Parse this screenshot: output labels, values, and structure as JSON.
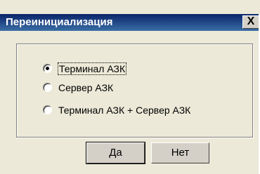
{
  "window": {
    "title": "Переинициализация",
    "close_glyph": "X"
  },
  "options": [
    {
      "label": "Терминал АЗК",
      "selected": true
    },
    {
      "label": "Сервер АЗК",
      "selected": false
    },
    {
      "label": "Терминал АЗК + Сервер АЗК",
      "selected": false
    }
  ],
  "buttons": {
    "yes_label": "Да",
    "no_label": "Нет"
  }
}
